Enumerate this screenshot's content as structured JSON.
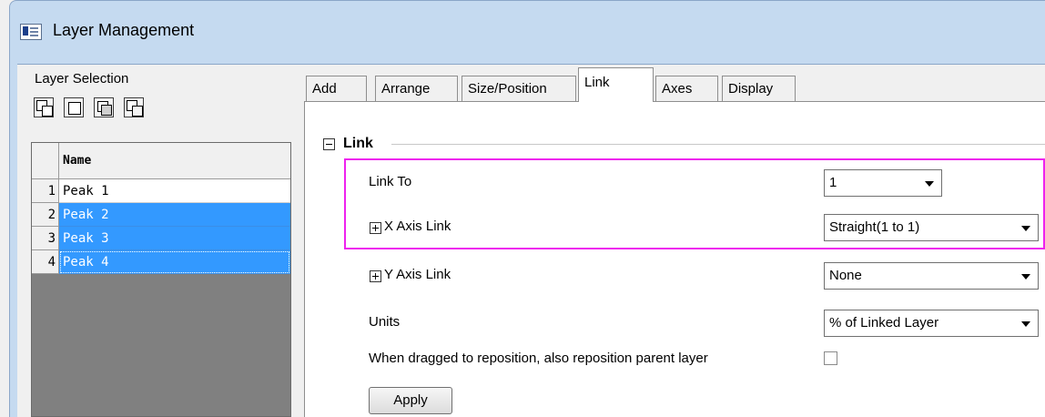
{
  "window": {
    "title": "Layer Management"
  },
  "layer_selection": {
    "label": "Layer Selection",
    "tool_icons": [
      "layer-arrange-icon-1",
      "layer-arrange-icon-2",
      "layer-arrange-icon-3",
      "layer-arrange-icon-4"
    ]
  },
  "layer_grid": {
    "header": "Name",
    "rows": [
      {
        "num": "1",
        "name": "Peak 1",
        "selected": false
      },
      {
        "num": "2",
        "name": "Peak 2",
        "selected": true
      },
      {
        "num": "3",
        "name": "Peak 3",
        "selected": true
      },
      {
        "num": "4",
        "name": "Peak 4",
        "selected": true
      }
    ]
  },
  "tabs": [
    "Add",
    "Arrange",
    "Size/Position",
    "Link",
    "Axes",
    "Display"
  ],
  "active_tab": "Link",
  "link_section": {
    "title": "Link",
    "link_to": {
      "label": "Link To",
      "value": "1"
    },
    "x_axis_link": {
      "label": "X Axis Link",
      "value": "Straight(1 to 1)"
    },
    "y_axis_link": {
      "label": "Y Axis Link",
      "value": "None"
    },
    "units": {
      "label": "Units",
      "value": "% of Linked Layer"
    },
    "reposition": {
      "label": "When dragged to reposition, also reposition parent layer",
      "checked": false
    },
    "apply_label": "Apply"
  },
  "colors": {
    "selection": "#3399ff",
    "highlight": "#ee22ee",
    "title_bar": "#c5daf0"
  }
}
